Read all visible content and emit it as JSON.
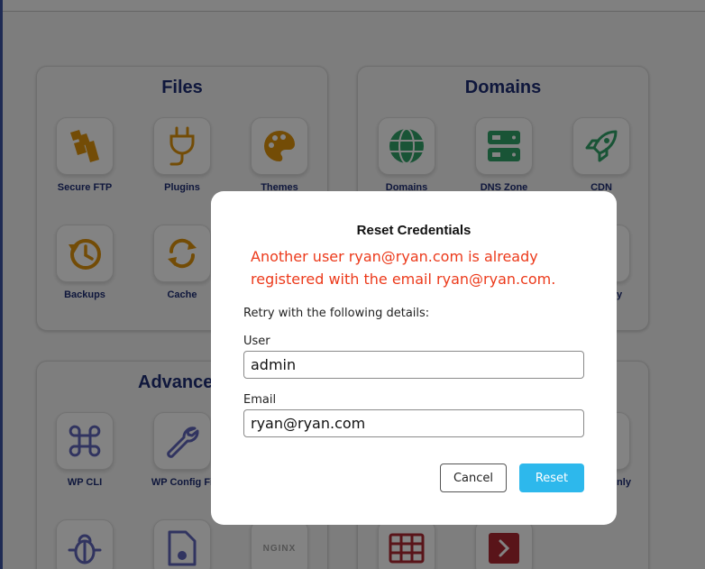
{
  "files_panel": {
    "title": "Files",
    "tiles": [
      {
        "label": "Secure FTP",
        "icon": "folders-icon"
      },
      {
        "label": "Plugins",
        "icon": "plug-icon"
      },
      {
        "label": "Themes",
        "icon": "palette-icon"
      },
      {
        "label": "Backups",
        "icon": "history-icon"
      },
      {
        "label": "Cache",
        "icon": "refresh-icon"
      }
    ]
  },
  "domains_panel": {
    "title": "Domains",
    "tiles": [
      {
        "label": "Domains",
        "icon": "globe-icon"
      },
      {
        "label": "DNS Zone",
        "icon": "server-icon"
      },
      {
        "label": "CDN",
        "icon": "rocket-icon"
      },
      {
        "label": "y",
        "icon": "document-icon"
      }
    ]
  },
  "advanced_panel": {
    "title": "Advance",
    "tiles": [
      {
        "label": "WP CLI",
        "icon": "command-icon"
      },
      {
        "label": "WP Config Fi",
        "icon": "wrench-icon"
      },
      {
        "label": "",
        "icon": "bug-icon"
      },
      {
        "label": "",
        "icon": "file-gear-icon"
      },
      {
        "label": "NGINX",
        "icon": "nginx-icon"
      }
    ]
  },
  "right_panel": {
    "tiles": [
      {
        "label": "nly",
        "icon": "flag-icon"
      },
      {
        "label": "",
        "icon": "table-icon"
      },
      {
        "label": "",
        "icon": "terminal-icon"
      }
    ]
  },
  "modal": {
    "title": "Reset Credentials",
    "error": "Another user ryan@ryan.com is already registered with the email ryan@ryan.com.",
    "subtitle": "Retry with the following details:",
    "user_label": "User",
    "user_value": "admin",
    "email_label": "Email",
    "email_value": "ryan@ryan.com",
    "cancel_label": "Cancel",
    "reset_label": "Reset"
  },
  "colors": {
    "accent": "#2db8ec",
    "error": "#ec3a1b",
    "heading": "#1c2b6e",
    "files_icon": "#d18a0c",
    "domains_icon": "#2e9a63",
    "advanced_icon": "#5a5fb0"
  }
}
